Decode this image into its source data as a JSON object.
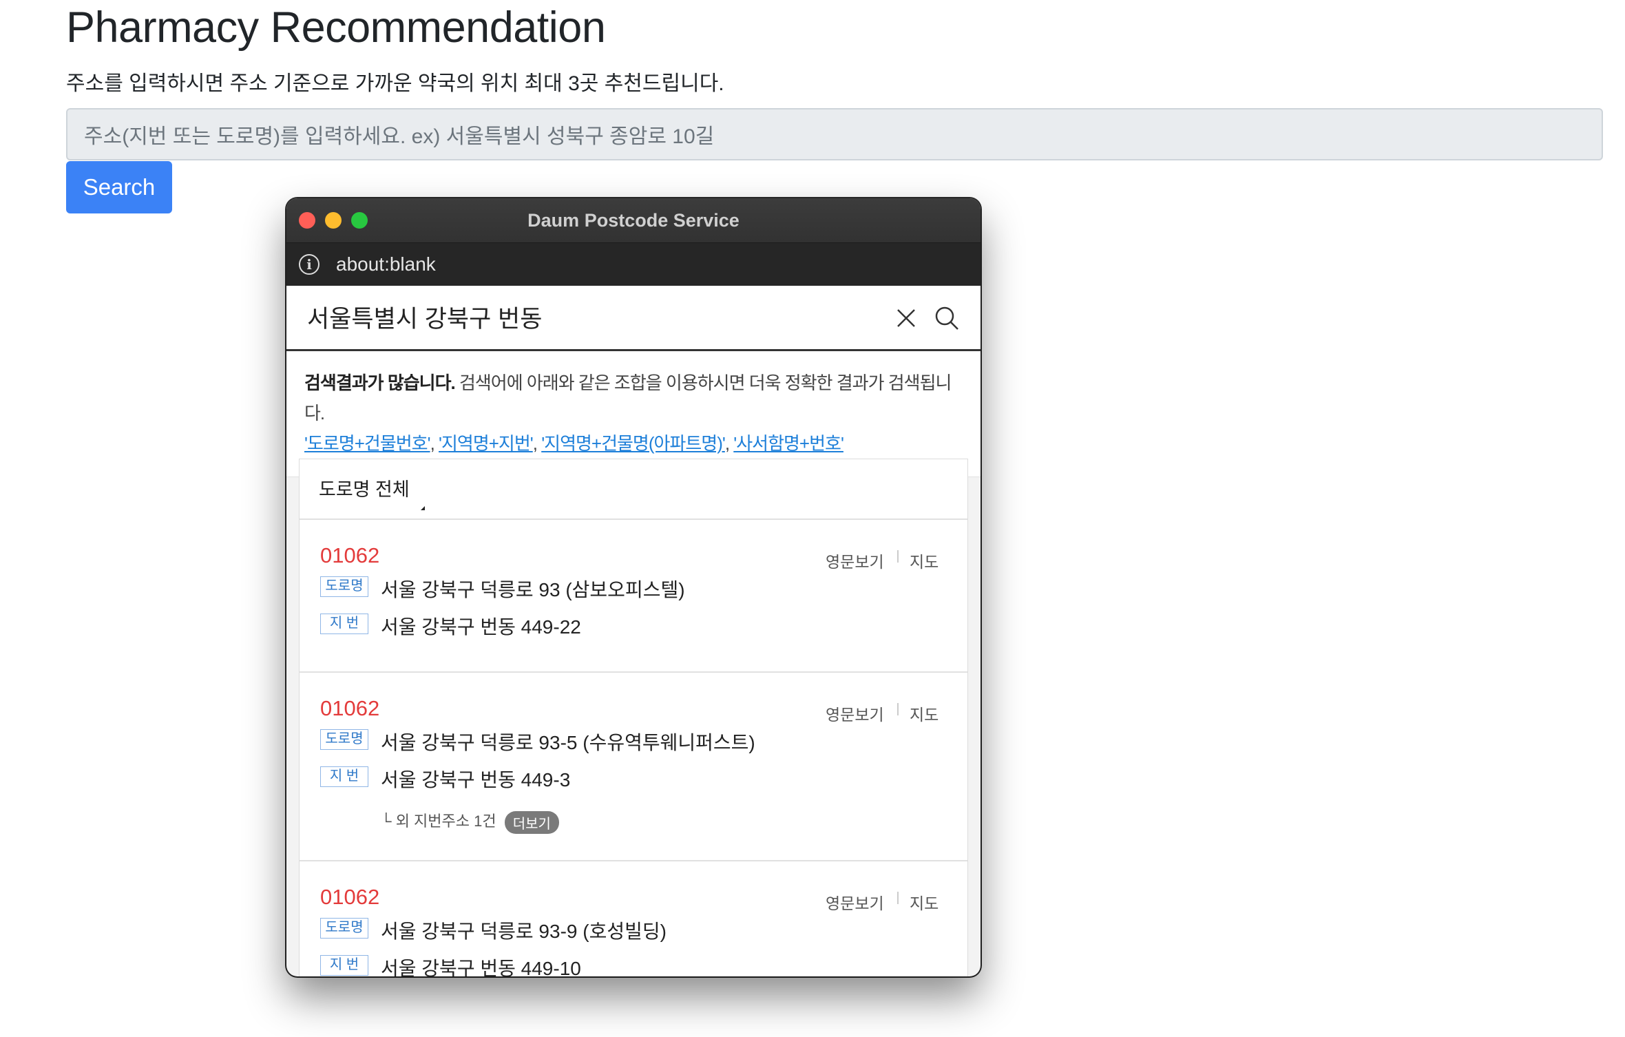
{
  "page": {
    "title": "Pharmacy Recommendation",
    "description": "주소를 입력하시면 주소 기준으로 가까운 약국의 위치 최대 3곳 추천드립니다.",
    "address_placeholder": "주소(지번 또는 도로명)를 입력하세요. ex) 서울특별시 성북구 종암로 10길",
    "search_label": "Search"
  },
  "popup": {
    "window_title": "Daum Postcode Service",
    "url": "about:blank",
    "query": "서울특별시 강북구 번동",
    "notice": {
      "bold": "검색결과가 많습니다.",
      "text": " 검색어에 아래와 같은 조합을 이용하시면 더욱 정확한 결과가 검색됩니다.",
      "tips": [
        "'도로명+건물번호'",
        "'지역명+지번'",
        "'지역명+건물명(아파트명)'",
        "'사서함명+번호'"
      ]
    },
    "filter_label": "도로명 전체",
    "road_badge": "도로명",
    "jibun_badge": "지 번",
    "eng_label": "영문보기",
    "map_label": "지도",
    "results": [
      {
        "zip": "01062",
        "road": "서울 강북구 덕릉로 93 (삼보오피스텔)",
        "jibun": "서울 강북구 번동 449-22"
      },
      {
        "zip": "01062",
        "road": "서울 강북구 덕릉로 93-5 (수유역투웨니퍼스트)",
        "jibun": "서울 강북구 번동 449-3",
        "extra": "└ 외 지번주소 1건",
        "more": "더보기"
      },
      {
        "zip": "01062",
        "road": "서울 강북구 덕릉로 93-9 (호성빌딩)",
        "jibun": "서울 강북구 번동 449-10"
      }
    ]
  },
  "colors": {
    "search_button": "#3b82f6",
    "zip_code": "#e33b3b",
    "link": "#1d7fd9"
  }
}
